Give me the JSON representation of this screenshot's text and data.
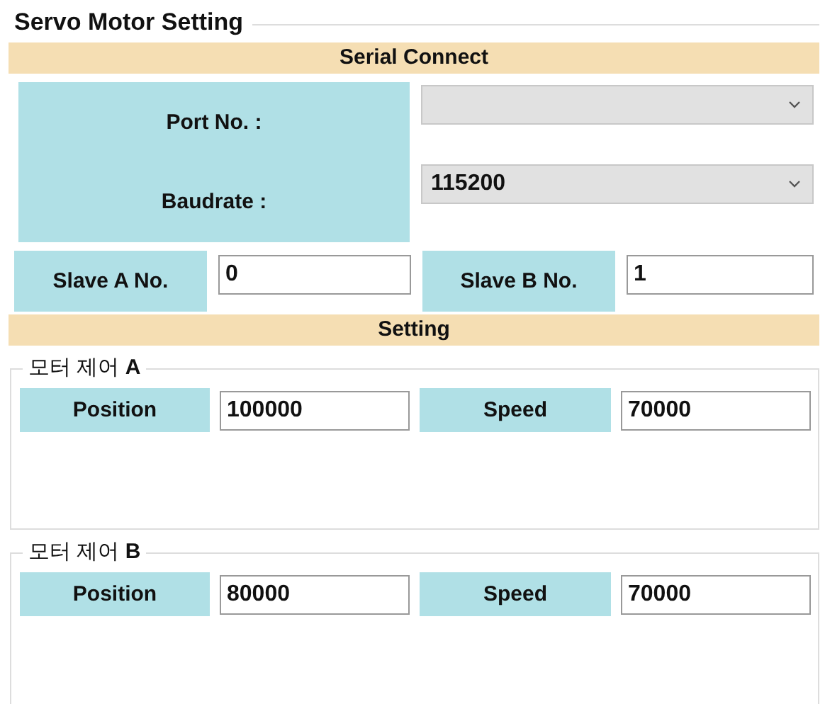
{
  "title": "Servo Motor Setting",
  "serial": {
    "header": "Serial Connect",
    "port_label": "Port No. :",
    "baud_label": "Baudrate :",
    "baud_value": "115200",
    "slaves": [
      {
        "label": "Slave A No.",
        "value": "0"
      },
      {
        "label": "Slave B No.",
        "value": "1"
      }
    ]
  },
  "setting": {
    "header": "Setting"
  },
  "motors": [
    {
      "title": "모터 제어 **A**",
      "fields": [
        {
          "label": "Position",
          "value": "100000"
        },
        {
          "label": "Speed",
          "value": "70000"
        }
      ]
    },
    {
      "title": "모터 제어 **B**",
      "fields": [
        {
          "label": "Position",
          "value": "80000"
        },
        {
          "label": "Speed",
          "value": "70000"
        }
      ]
    }
  ]
}
